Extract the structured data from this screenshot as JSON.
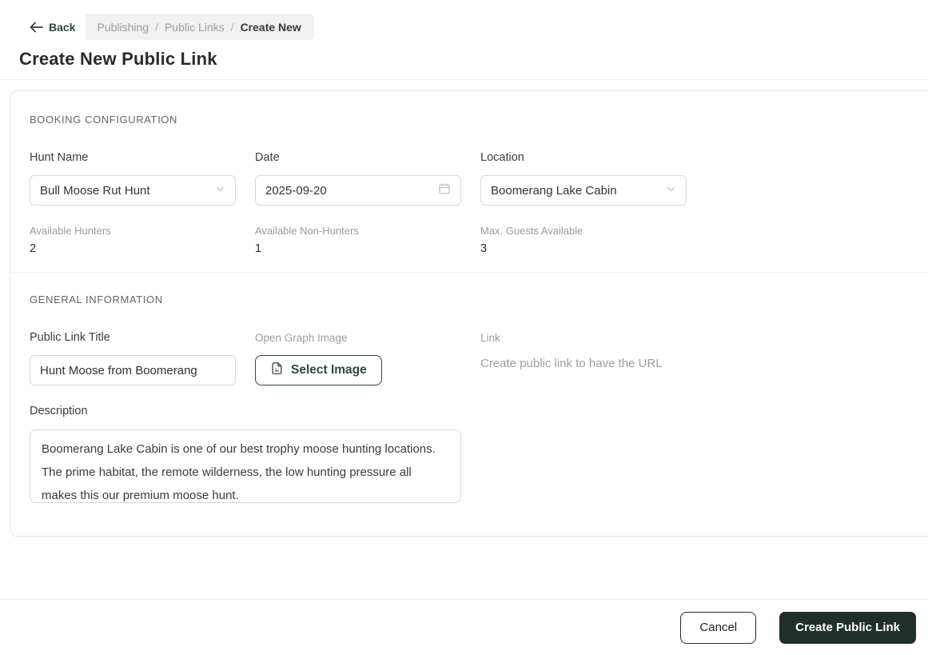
{
  "header": {
    "back_label": "Back",
    "breadcrumb": {
      "separator": "/",
      "items": [
        "Publishing",
        "Public Links",
        "Create New"
      ]
    },
    "title": "Create New Public Link"
  },
  "booking": {
    "section_title": "BOOKING CONFIGURATION",
    "hunt_name": {
      "label": "Hunt Name",
      "value": "Bull Moose Rut Hunt"
    },
    "date": {
      "label": "Date",
      "value": "2025-09-20"
    },
    "location": {
      "label": "Location",
      "value": "Boomerang Lake Cabin"
    },
    "stats": [
      {
        "label": "Available Hunters",
        "value": "2"
      },
      {
        "label": "Available Non-Hunters",
        "value": "1"
      },
      {
        "label": "Max. Guests Available",
        "value": "3"
      }
    ]
  },
  "general": {
    "section_title": "GENERAL INFORMATION",
    "public_link_title": {
      "label": "Public Link Title",
      "value": "Hunt Moose from Boomerang"
    },
    "open_graph": {
      "label": "Open Graph Image",
      "button_label": "Select Image"
    },
    "link": {
      "label": "Link",
      "helper_text": "Create public link to have the URL"
    },
    "description": {
      "label": "Description",
      "value": "Boomerang Lake Cabin is one of our best trophy moose hunting locations.  The prime habitat, the remote wilderness, the low hunting pressure all makes this our premium moose hunt."
    }
  },
  "footer": {
    "cancel_label": "Cancel",
    "submit_label": "Create Public Link"
  },
  "colors": {
    "accent_green": "#2d4a3c",
    "submit_button_bg": "#203028",
    "label_gray": "#9e9e9e",
    "border_gray": "#d9d9d9",
    "breadcrumb_bg": "#f1f1f1"
  }
}
